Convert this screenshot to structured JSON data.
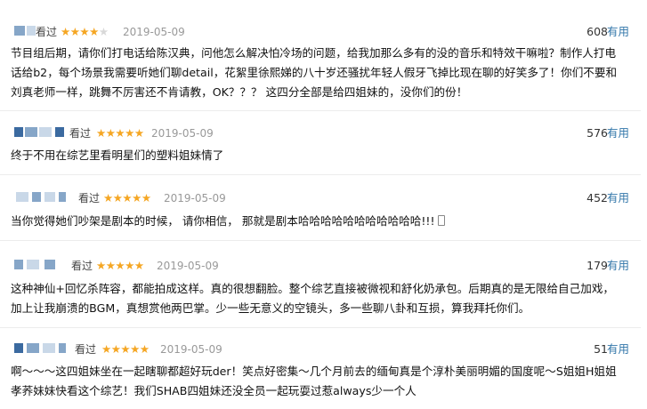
{
  "comments": [
    {
      "seen": "看过",
      "stars": "★★★★",
      "stars_off": "★",
      "date": "2019-05-09",
      "votes": "608",
      "useful": "有用",
      "text": "节目组后期，请你们打电话给陈汉典，问他怎么解决怕冷场的问题，给我加那么多有的没的音乐和特效干嘛啦？制作人打电话给b2，每个场景我需要听她们聊detail，花絮里徐熙娣的八十岁还骚扰年轻人假牙飞掉比现在聊的好笑多了！你们不要和刘真老师一样，跳舞不厉害还不肯请教，OK？？？ 这四分全部是给四姐妹的，没你们的份！"
    },
    {
      "seen": "看过",
      "stars": "★★★★★",
      "stars_off": "",
      "date": "2019-05-09",
      "votes": "576",
      "useful": "有用",
      "text": "终于不用在综艺里看明星们的塑料姐妹情了"
    },
    {
      "seen": "看过",
      "stars": "★★★★★",
      "stars_off": "",
      "date": "2019-05-09",
      "votes": "452",
      "useful": "有用",
      "text": "当你觉得她们吵架是剧本的时候， 请你相信， 那就是剧本哈哈哈哈哈哈哈哈哈哈哈!!!"
    },
    {
      "seen": "看过",
      "stars": "★★★★★",
      "stars_off": "",
      "date": "2019-05-09",
      "votes": "179",
      "useful": "有用",
      "text": "这种神仙+回忆杀阵容，都能拍成这样。真的很想翻脸。整个综艺直接被微视和舒化奶承包。后期真的是无限给自己加戏，加上让我崩溃的BGM，真想赏他两巴掌。少一些无意义的空镜头，多一些聊八卦和互损，算我拜托你们。"
    },
    {
      "seen": "看过",
      "stars": "★★★★★",
      "stars_off": "",
      "date": "2019-05-09",
      "votes": "51",
      "useful": "有用",
      "text": "啊～～～这四姐妹坐在一起瞎聊都超好玩der！笑点好密集～几个月前去的缅甸真是个淳朴美丽明媚的国度呢～S姐姐H姐姐孝荞妹妹快看这个综艺！我们SHAB四姐妹还没全员一起玩耍过惹always少一个人"
    }
  ],
  "colors": {
    "star": "#f5a623",
    "link": "#37a",
    "date": "#999999"
  }
}
